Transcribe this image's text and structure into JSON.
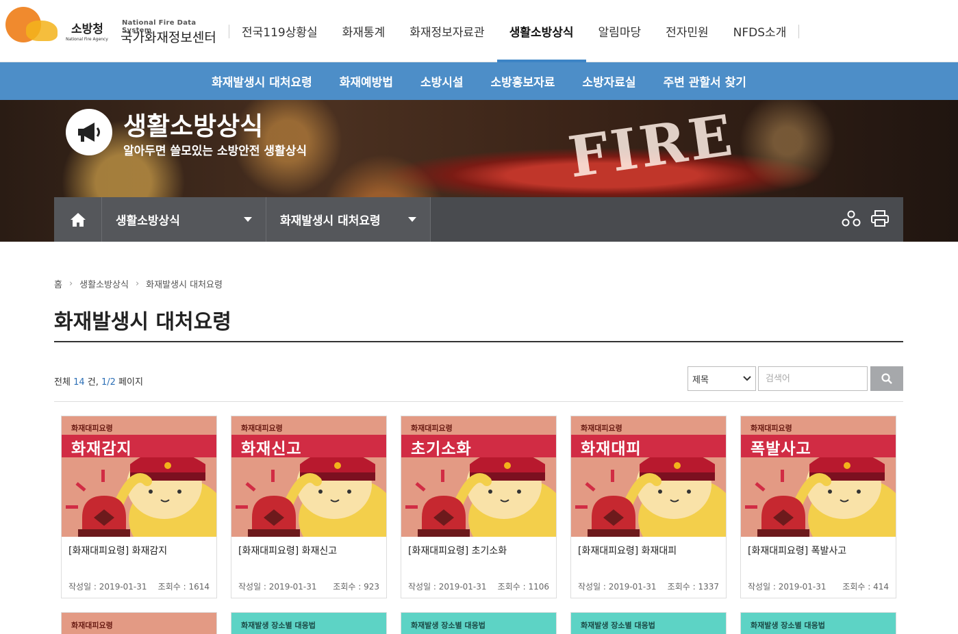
{
  "header": {
    "logo_org": "소방청",
    "logo_org_sub": "National Fire Agency",
    "logo_eng": "National Fire Data System",
    "logo_kor": "국가화재정보센터",
    "gnb": [
      "전국119상황실",
      "화재통계",
      "화재정보자료관",
      "생활소방상식",
      "알림마당",
      "전자민원",
      "NFDS소개"
    ],
    "active_gnb": "생활소방상식"
  },
  "subnav": [
    "화재발생시 대처요령",
    "화재예방법",
    "소방시설",
    "소방홍보자료",
    "소방자료실",
    "주변 관할서 찾기"
  ],
  "hero": {
    "title": "생활소방상식",
    "subtitle": "알아두면 쓸모있는 소방안전 생활상식",
    "bg_text": "FIRE"
  },
  "location": {
    "depth1": "생활소방상식",
    "depth2": "화재발생시 대처요령"
  },
  "breadcrumb": [
    "홈",
    "생활소방상식",
    "화재발생시 대처요령"
  ],
  "page_title": "화재발생시 대처요령",
  "list_info": {
    "prefix": "전체 ",
    "total": "14",
    "mid": " 건, ",
    "page": "1/2",
    "suffix": " 페이지"
  },
  "search": {
    "select_value": "제목",
    "placeholder": "검색어"
  },
  "cards": [
    {
      "tag": "화재대피요령",
      "word": "화재감지",
      "title": "[화재대피요령] 화재감지",
      "date": "작성일 : 2019-01-31",
      "views": "조회수 : 1614"
    },
    {
      "tag": "화재대피요령",
      "word": "화재신고",
      "title": "[화재대피요령] 화재신고",
      "date": "작성일 : 2019-01-31",
      "views": "조회수 : 923"
    },
    {
      "tag": "화재대피요령",
      "word": "초기소화",
      "title": "[화재대피요령] 초기소화",
      "date": "작성일 : 2019-01-31",
      "views": "조회수 : 1106"
    },
    {
      "tag": "화재대피요령",
      "word": "화재대피",
      "title": "[화재대피요령] 화재대피",
      "date": "작성일 : 2019-01-31",
      "views": "조회수 : 1337"
    },
    {
      "tag": "화재대피요령",
      "word": "폭발사고",
      "title": "[화재대피요령] 폭발사고",
      "date": "작성일 : 2019-01-31",
      "views": "조회수 : 414"
    }
  ],
  "cards_row2": [
    {
      "tag": "화재대피요령",
      "color": "#e39a84",
      "text_color": "#6a1c14"
    },
    {
      "tag": "화재발생 장소별 대응법",
      "color": "#5dd3c5",
      "text_color": "#1b4a46"
    },
    {
      "tag": "화재발생 장소별 대응법",
      "color": "#5dd3c5",
      "text_color": "#1b4a46"
    },
    {
      "tag": "화재발생 장소별 대응법",
      "color": "#5dd3c5",
      "text_color": "#1b4a46"
    },
    {
      "tag": "화재발생 장소별 대응법",
      "color": "#5dd3c5",
      "text_color": "#1b4a46"
    }
  ],
  "colors": {
    "accent": "#4d8ec8",
    "location_bar": "#494b4f",
    "card_thumb": "#e39a84",
    "card_band": "#d12c44"
  }
}
